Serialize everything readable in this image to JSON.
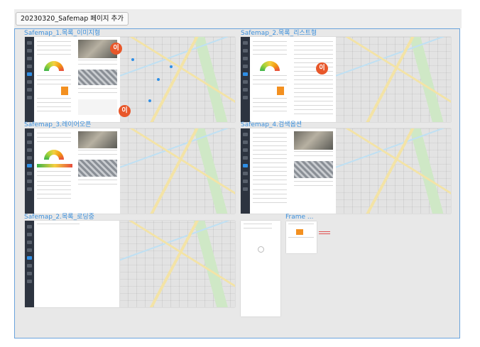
{
  "tab": {
    "label": "20230320_Safemap 페이지 추가"
  },
  "frames": {
    "f1": {
      "label": "Safemap_1.목록_이미지형",
      "badge_top": "이",
      "badge_bottom": "이"
    },
    "f2": {
      "label": "Safemap_2.목록_리스트형",
      "badge": "이"
    },
    "f3": {
      "label": "Safemap_3.레이어오픈"
    },
    "f4": {
      "label": "Safemap_4.검색옵션"
    },
    "f5": {
      "label": "Safemap_2.목록_로딩중"
    },
    "f6": {
      "label": "Frame ..."
    }
  },
  "colors": {
    "accent": "#3b8fdc",
    "badge": "#e8572a",
    "sidebar": "#2d3440",
    "orange": "#f39020"
  }
}
